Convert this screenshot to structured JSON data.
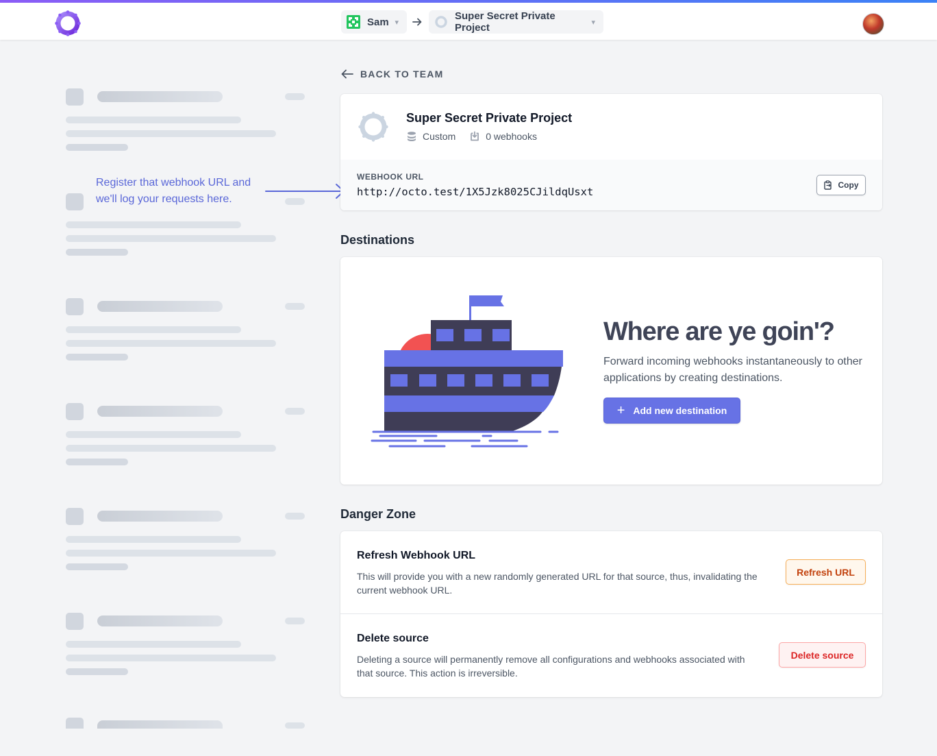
{
  "header": {
    "logo_icon": "octo-ring-logo",
    "team": {
      "label": "Sam",
      "icon": "team-pattern-icon",
      "chevron": "▾"
    },
    "project": {
      "label": "Super Secret Private Project",
      "icon": "project-ring-icon",
      "chevron": "▾"
    },
    "avatar_icon": "user-avatar"
  },
  "sidebar": {
    "annotation": "Register that webhook URL and we'll log your requests here."
  },
  "main": {
    "back_label": "BACK TO TEAM",
    "project": {
      "title": "Super Secret Private Project",
      "type": "Custom",
      "webhooks_count": "0 webhooks",
      "webhook_url_label": "WEBHOOK URL",
      "webhook_url": "http://octo.test/1X5Jzk8025CJildqUsxt",
      "copy_label": "Copy"
    },
    "destinations": {
      "section_title": "Destinations",
      "empty_title": "Where are ye goin'?",
      "empty_desc": "Forward incoming webhooks instantaneously to other applications by creating destinations.",
      "add_label": "Add new destination",
      "add_icon": "+"
    },
    "danger_zone": {
      "section_title": "Danger Zone",
      "refresh": {
        "title": "Refresh Webhook URL",
        "desc": "This will provide you with a new randomly generated URL for that source, thus, invalidating the current webhook URL.",
        "button": "Refresh URL"
      },
      "delete": {
        "title": "Delete source",
        "desc": "Deleting a source will permanently remove all configurations and webhooks associated with that source. This action is irreversible.",
        "button": "Delete source"
      }
    }
  },
  "colors": {
    "accent": "#6772e5",
    "annotation": "#5a67d8",
    "refresh_text": "#c2410c",
    "delete_text": "#dc2626"
  }
}
